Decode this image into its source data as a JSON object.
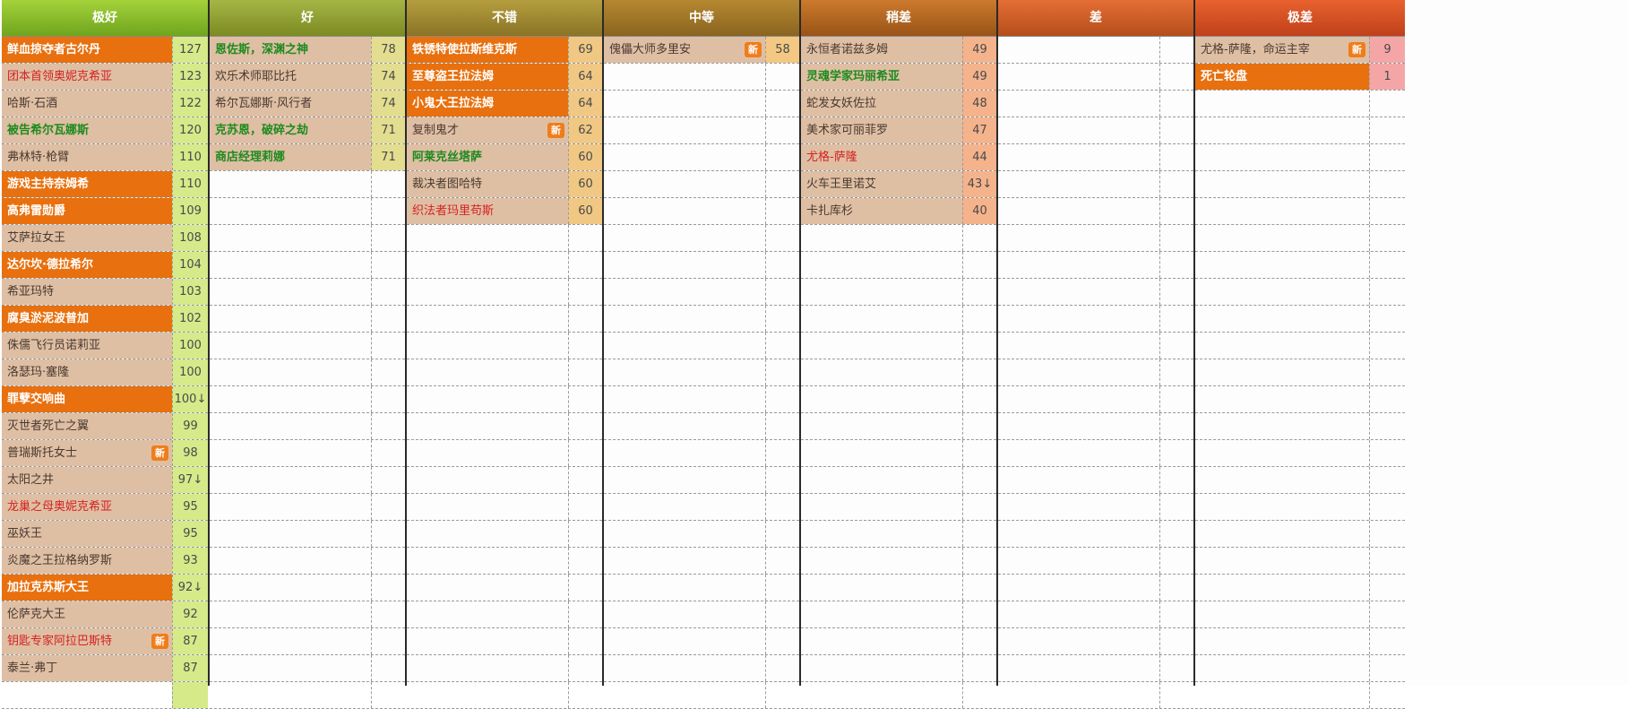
{
  "colors": {
    "header_gradients": [
      [
        "#a4d23a",
        "#6fa51e"
      ],
      [
        "#a6b645",
        "#7c8a22"
      ],
      [
        "#b59e3e",
        "#8a7426"
      ],
      [
        "#b58830",
        "#8a6420"
      ],
      [
        "#cc7a2c",
        "#9a5418"
      ],
      [
        "#e66e34",
        "#b44e1c"
      ],
      [
        "#e8622e",
        "#c0401a"
      ]
    ],
    "score_bgs": [
      "#d6ea8a",
      "#e3dd8f",
      "#f0c883",
      "#f2c883",
      "#f5b38c",
      "#f4a69a",
      "#f4a6a6"
    ],
    "name_bg": "#dfbfa4",
    "name_bg_highlight": "#e8700e"
  },
  "tiers": [
    {
      "label": "极好",
      "items": [
        {
          "name": "鲜血掠夺者古尔丹",
          "score": "127",
          "style": "hl",
          "new": false
        },
        {
          "name": "团本首领奥妮克希亚",
          "score": "123",
          "style": "red",
          "new": false
        },
        {
          "name": "哈斯·石酒",
          "score": "122",
          "style": "",
          "new": false
        },
        {
          "name": "被告希尔瓦娜斯",
          "score": "120",
          "style": "green",
          "new": false
        },
        {
          "name": "弗林特·枪臂",
          "score": "110",
          "style": "",
          "new": false
        },
        {
          "name": "游戏主持奈姆希",
          "score": "110",
          "style": "hl",
          "new": false
        },
        {
          "name": "高弗雷勋爵",
          "score": "109",
          "style": "hl",
          "new": false
        },
        {
          "name": "艾萨拉女王",
          "score": "108",
          "style": "",
          "new": false
        },
        {
          "name": "达尔坎·德拉希尔",
          "score": "104",
          "style": "hl",
          "new": false
        },
        {
          "name": "希亚玛特",
          "score": "103",
          "style": "",
          "new": false
        },
        {
          "name": "腐臭淤泥波普加",
          "score": "102",
          "style": "hl",
          "new": false
        },
        {
          "name": "侏儒飞行员诺莉亚",
          "score": "100",
          "style": "",
          "new": false
        },
        {
          "name": "洛瑟玛·塞隆",
          "score": "100",
          "style": "",
          "new": false
        },
        {
          "name": "罪孽交响曲",
          "score": "100↓",
          "style": "hl",
          "new": false
        },
        {
          "name": "灭世者死亡之翼",
          "score": "99",
          "style": "",
          "new": false
        },
        {
          "name": "普瑞斯托女士",
          "score": "98",
          "style": "",
          "new": true
        },
        {
          "name": "太阳之井",
          "score": "97↓",
          "style": "",
          "new": false
        },
        {
          "name": "龙巢之母奥妮克希亚",
          "score": "95",
          "style": "red",
          "new": false
        },
        {
          "name": "巫妖王",
          "score": "95",
          "style": "",
          "new": false
        },
        {
          "name": "炎魔之王拉格纳罗斯",
          "score": "93",
          "style": "",
          "new": false
        },
        {
          "name": "加拉克苏斯大王",
          "score": "92↓",
          "style": "hl",
          "new": false
        },
        {
          "name": "伦萨克大王",
          "score": "92",
          "style": "",
          "new": false
        },
        {
          "name": "钥匙专家阿拉巴斯特",
          "score": "87",
          "style": "red",
          "new": true
        },
        {
          "name": "泰兰·弗丁",
          "score": "87",
          "style": "",
          "new": false
        }
      ]
    },
    {
      "label": "好",
      "items": [
        {
          "name": "恩佐斯，深渊之神",
          "score": "78",
          "style": "green",
          "new": false
        },
        {
          "name": "欢乐术师耶比托",
          "score": "74",
          "style": "",
          "new": false
        },
        {
          "name": "希尔瓦娜斯·风行者",
          "score": "74",
          "style": "",
          "new": false
        },
        {
          "name": "克苏恩，破碎之劫",
          "score": "71",
          "style": "green",
          "new": false
        },
        {
          "name": "商店经理莉娜",
          "score": "71",
          "style": "green",
          "new": false
        }
      ]
    },
    {
      "label": "不错",
      "items": [
        {
          "name": "铁锈特使拉斯维克斯",
          "score": "69",
          "style": "hl",
          "new": false
        },
        {
          "name": "至尊盗王拉法姆",
          "score": "64",
          "style": "hl",
          "new": false
        },
        {
          "name": "小鬼大王拉法姆",
          "score": "64",
          "style": "hl",
          "new": false
        },
        {
          "name": "复制鬼才",
          "score": "62",
          "style": "",
          "new": true
        },
        {
          "name": "阿莱克丝塔萨",
          "score": "60",
          "style": "green",
          "new": false
        },
        {
          "name": "裁决者图哈特",
          "score": "60",
          "style": "",
          "new": false
        },
        {
          "name": "织法者玛里苟斯",
          "score": "60",
          "style": "red",
          "new": false
        }
      ]
    },
    {
      "label": "中等",
      "items": [
        {
          "name": "傀儡大师多里安",
          "score": "58",
          "style": "",
          "new": true
        }
      ]
    },
    {
      "label": "稍差",
      "items": [
        {
          "name": "永恒者诺兹多姆",
          "score": "49",
          "style": "",
          "new": false
        },
        {
          "name": "灵魂学家玛丽希亚",
          "score": "49",
          "style": "green",
          "new": false
        },
        {
          "name": "蛇发女妖佐拉",
          "score": "48",
          "style": "",
          "new": false
        },
        {
          "name": "美术家可丽菲罗",
          "score": "47",
          "style": "",
          "new": false
        },
        {
          "name": "尤格-萨隆",
          "score": "44",
          "style": "red",
          "new": false
        },
        {
          "name": "火车王里诺艾",
          "score": "43↓",
          "style": "",
          "new": false
        },
        {
          "name": "卡扎库杉",
          "score": "40",
          "style": "",
          "new": false
        }
      ]
    },
    {
      "label": "差",
      "items": []
    },
    {
      "label": "极差",
      "items": [
        {
          "name": "尤格-萨隆，命运主宰",
          "score": "9",
          "style": "",
          "new": true
        },
        {
          "name": "死亡轮盘",
          "score": "1",
          "style": "hl",
          "new": false
        }
      ]
    }
  ],
  "new_badge_label": "新"
}
